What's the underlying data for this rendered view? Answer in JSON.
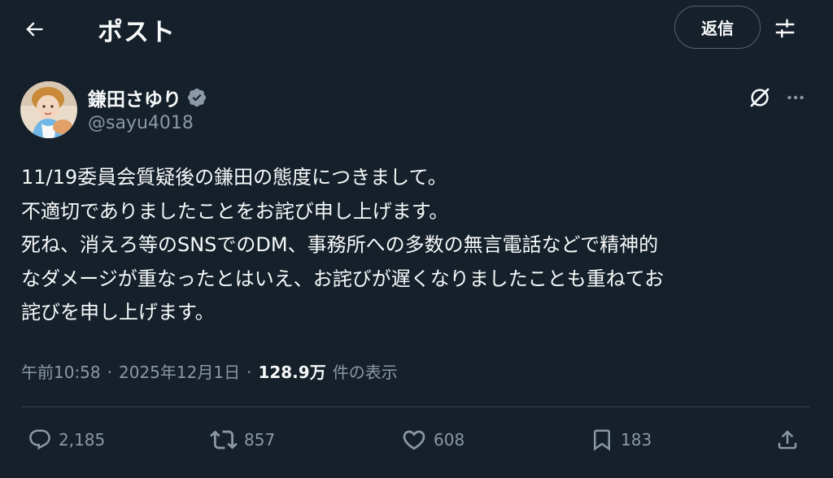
{
  "header": {
    "title": "ポスト",
    "reply_label": "返信"
  },
  "icons": {
    "back": "arrow-left-icon",
    "adjust": "adjust-icon",
    "verified": "verified-badge-icon",
    "grok": "grok-icon",
    "more": "more-icon",
    "reply": "reply-icon",
    "repost": "repost-icon",
    "like": "heart-icon",
    "bookmark": "bookmark-icon",
    "share": "share-icon"
  },
  "author": {
    "display_name": "鎌田さゆり",
    "handle": "@sayu4018"
  },
  "tweet": {
    "lines": [
      "11/19委員会質疑後の鎌田の態度につきまして。",
      "不適切でありましたことをお詫び申し上げます。",
      "死ね、消えろ等のSNSでのDM、事務所への多数の無言電話などで精神的",
      "なダメージが重なったとはいえ、お詫びが遅くなりましたことも重ねてお",
      "詫びを申し上げます。"
    ]
  },
  "meta": {
    "time": "午前10:58",
    "separator": "·",
    "date": "2025年12月1日",
    "views": "128.9万",
    "views_label": "件の表示"
  },
  "stats": {
    "replies": "2,185",
    "reposts": "857",
    "likes": "608",
    "bookmarks": "183"
  },
  "colors": {
    "background": "#15202b",
    "text": "#f7f9f9",
    "secondary": "#8b98a5",
    "border": "#38444d",
    "verified": "#8b98a5"
  }
}
